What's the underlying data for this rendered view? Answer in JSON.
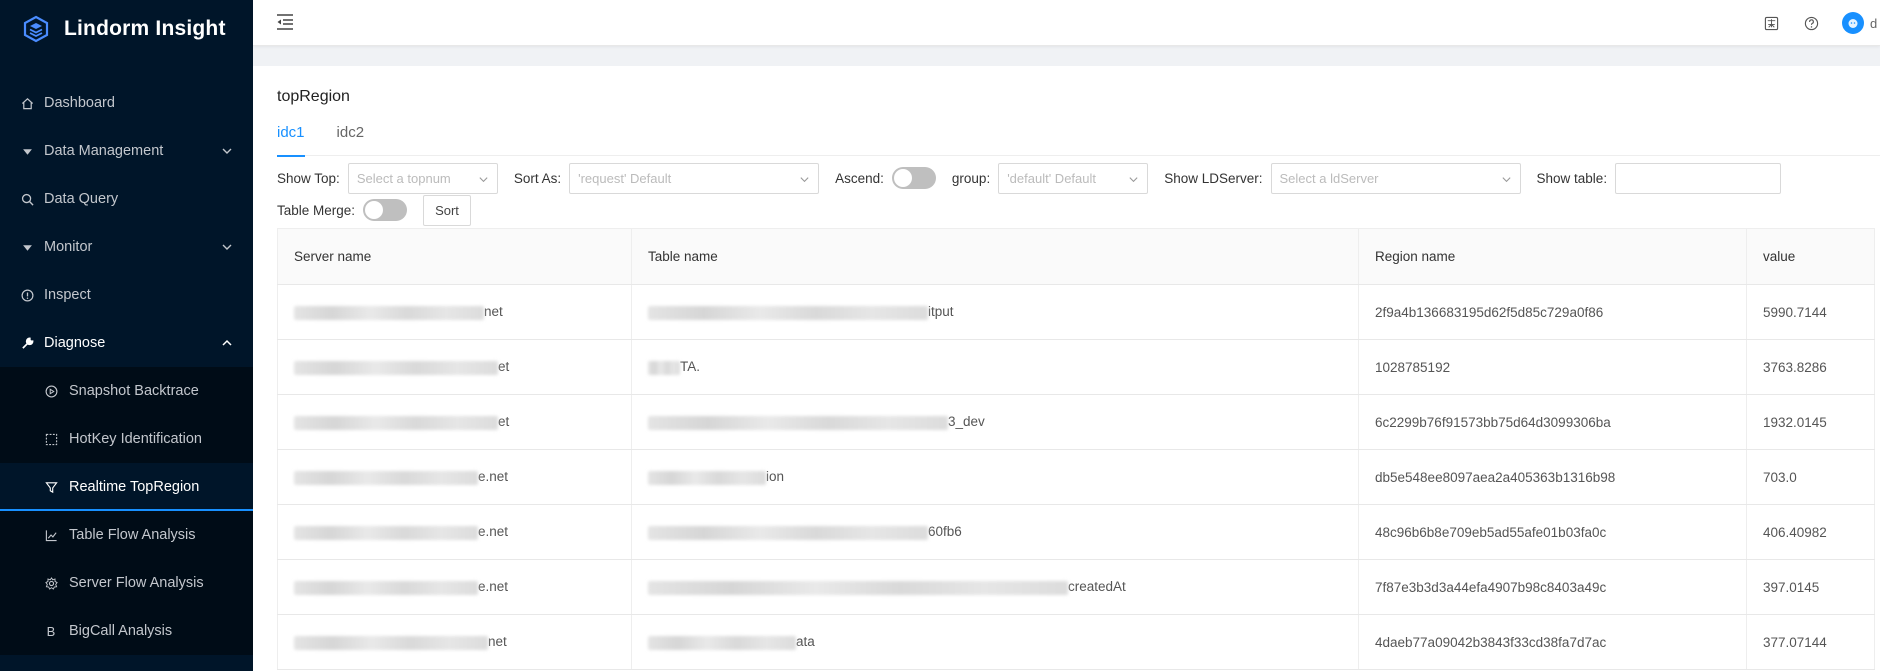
{
  "app": {
    "title": "Lindorm Insight"
  },
  "sidebar": {
    "items": [
      {
        "label": "Dashboard",
        "icon": "home-icon"
      },
      {
        "label": "Data Management",
        "icon": "caret-down-icon",
        "expandable": true
      },
      {
        "label": "Data Query",
        "icon": "search-icon"
      },
      {
        "label": "Monitor",
        "icon": "caret-down-icon",
        "expandable": true
      },
      {
        "label": "Inspect",
        "icon": "info-circle-icon"
      },
      {
        "label": "Diagnose",
        "icon": "wrench-icon",
        "expanded": true
      }
    ],
    "subitems": [
      {
        "label": "Snapshot Backtrace",
        "icon": "play-circle-icon"
      },
      {
        "label": "HotKey Identification",
        "icon": "dashed-square-icon"
      },
      {
        "label": "Realtime TopRegion",
        "icon": "filter-icon",
        "selected": true
      },
      {
        "label": "Table Flow Analysis",
        "icon": "line-chart-icon"
      },
      {
        "label": "Server Flow Analysis",
        "icon": "gear-icon"
      },
      {
        "label": "BigCall Analysis",
        "icon": "letter-b-icon"
      }
    ]
  },
  "header": {
    "user_initial": "d"
  },
  "page": {
    "title": "topRegion",
    "tabs": [
      {
        "label": "idc1",
        "active": true
      },
      {
        "label": "idc2"
      }
    ]
  },
  "filters": {
    "show_top_label": "Show Top",
    "show_top_placeholder": "Select a topnum",
    "sort_as_label": "Sort As",
    "sort_as_placeholder": "'request' Default",
    "ascend_label": "Ascend",
    "group_label": "group",
    "group_placeholder": "'default' Default",
    "ldserver_label": "Show LDServer",
    "ldserver_placeholder": "Select a ldServer",
    "show_table_label": "Show table",
    "table_merge_label": "Table Merge",
    "sort_button": "Sort"
  },
  "table": {
    "columns": [
      "Server name",
      "Table name",
      "Region name",
      "value"
    ],
    "rows": [
      {
        "server": "net",
        "table": "itput",
        "region": "2f9a4b136683195d62f5d85c729a0f86",
        "value": "5990.7144"
      },
      {
        "server": "et",
        "table": "TA.",
        "region": "1028785192",
        "value": "3763.8286"
      },
      {
        "server": "et",
        "table": "3_dev",
        "region": "6c2299b76f91573bb75d64d3099306ba",
        "value": "1932.0145"
      },
      {
        "server": "e.net",
        "table": "ion",
        "region": "db5e548ee8097aea2a405363b1316b98",
        "value": "703.0"
      },
      {
        "server": "e.net",
        "table": "60fb6",
        "region": "48c96b6b8e709eb5ad55afe01b03fa0c",
        "value": "406.40982"
      },
      {
        "server": "e.net",
        "table": "createdAt",
        "region": "7f87e3b3d3a44efa4907b98c8403a49c",
        "value": "397.0145"
      },
      {
        "server": "net",
        "table": "ata",
        "region": "4daeb77a09042b3843f33cd38fa7d7ac",
        "value": "377.07144"
      }
    ]
  },
  "colors": {
    "sidebar_bg": "#001529",
    "submenu_bg": "#000c17",
    "accent": "#1890ff"
  }
}
